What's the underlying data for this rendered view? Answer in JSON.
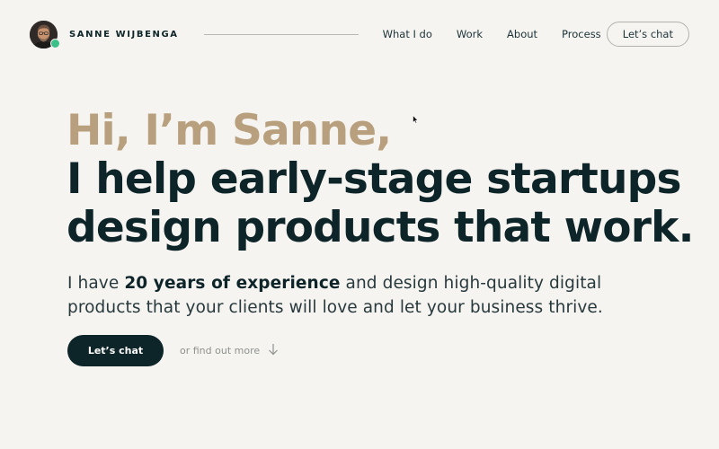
{
  "header": {
    "brand_name": "SANNE WIJBENGA",
    "nav": [
      {
        "label": "What I do"
      },
      {
        "label": "Work"
      },
      {
        "label": "About"
      },
      {
        "label": "Process"
      }
    ],
    "chat_label": "Let’s chat",
    "status_color": "#3cc08a"
  },
  "hero": {
    "greeting": "Hi, I’m Sanne,",
    "greeting_color": "#b8a07e",
    "headline_line1": "I help early-stage startups",
    "headline_line2": "design products that work.",
    "intro_before": "I have ",
    "intro_bold": "20 years of experience",
    "intro_after": " and design high-quality digital",
    "intro_line2": "products that your clients will love and let your business thrive.",
    "cta_label": "Let’s chat",
    "find_more_label": "or find out more"
  },
  "icons": {
    "arrow": "arrow-down-icon",
    "cursor": "mouse-pointer-icon"
  },
  "colors": {
    "background": "#f6f4f0",
    "ink": "#0d2429",
    "accent": "#b8a07e"
  }
}
